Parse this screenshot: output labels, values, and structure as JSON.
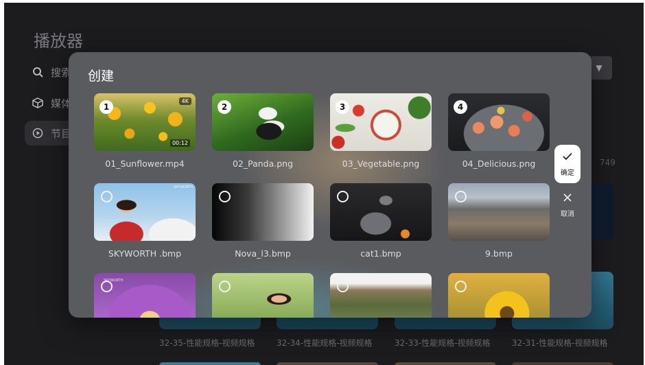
{
  "app": {
    "title": "播放器",
    "nav": [
      {
        "label": "搜索",
        "icon": "search-icon"
      },
      {
        "label": "媒体",
        "icon": "cube-icon"
      },
      {
        "label": "节目",
        "icon": "play-circle-icon"
      }
    ],
    "sort_icon": "caret-down-icon",
    "background_captions": [
      "32-35-性能规格-视频规格",
      "32-34-性能规格-视频规格",
      "32-33-性能规格-视频规格",
      "32-31-性能规格-视频规格"
    ],
    "background_number": "749"
  },
  "dialog": {
    "title": "创建",
    "items": [
      {
        "label": "01_Sunflower.mp4",
        "order": "1",
        "selected": true,
        "quality": "4K",
        "duration": "00:12"
      },
      {
        "label": "02_Panda.png",
        "order": "2",
        "selected": true
      },
      {
        "label": "03_Vegetable.png",
        "order": "3",
        "selected": true
      },
      {
        "label": "04_Delicious.png",
        "order": "4",
        "selected": true
      },
      {
        "label": "SKYWORTH .bmp",
        "selected": false
      },
      {
        "label": "Nova_l3.bmp",
        "selected": false
      },
      {
        "label": "cat1.bmp",
        "selected": false
      },
      {
        "label": "9.bmp",
        "selected": false
      },
      {
        "label": "",
        "selected": false
      },
      {
        "label": "",
        "selected": false
      },
      {
        "label": "",
        "selected": false
      },
      {
        "label": "",
        "selected": false
      }
    ],
    "confirm_label": "确定",
    "cancel_label": "取消"
  },
  "colors": {
    "dialog_bg": "#5a5b5f",
    "screen_bg": "#1c1c1f",
    "confirm_bg": "#ffffff"
  }
}
